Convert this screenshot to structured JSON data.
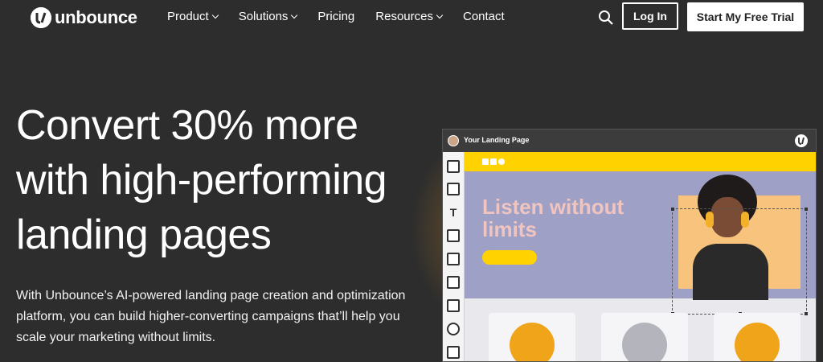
{
  "brand": {
    "name": "unbounce"
  },
  "nav": {
    "items": [
      {
        "label": "Product",
        "dropdown": true
      },
      {
        "label": "Solutions",
        "dropdown": true
      },
      {
        "label": "Pricing",
        "dropdown": false
      },
      {
        "label": "Resources",
        "dropdown": true
      },
      {
        "label": "Contact",
        "dropdown": false
      }
    ],
    "search_icon": "search-icon",
    "login_label": "Log In",
    "trial_label": "Start My Free Trial"
  },
  "hero": {
    "headline": "Convert 30% more with high-performing landing pages",
    "subtext": "With Unbounce’s AI-powered landing page creation and optimization platform, you can build higher-converting campaigns that’ll help you scale your marketing without limits."
  },
  "mockup": {
    "window_title": "Your Landing Page",
    "canvas_heading": "Listen without limits",
    "tool_icons": [
      "section-icon",
      "box-icon",
      "text-icon",
      "image-icon",
      "image-box-icon",
      "form-icon",
      "list-icon",
      "video-icon",
      "code-icon"
    ]
  },
  "colors": {
    "background": "#2d2d2d",
    "accent_yellow": "#ffd200",
    "canvas_purple": "#9fa0c6",
    "canvas_text": "#f0c5c0"
  }
}
